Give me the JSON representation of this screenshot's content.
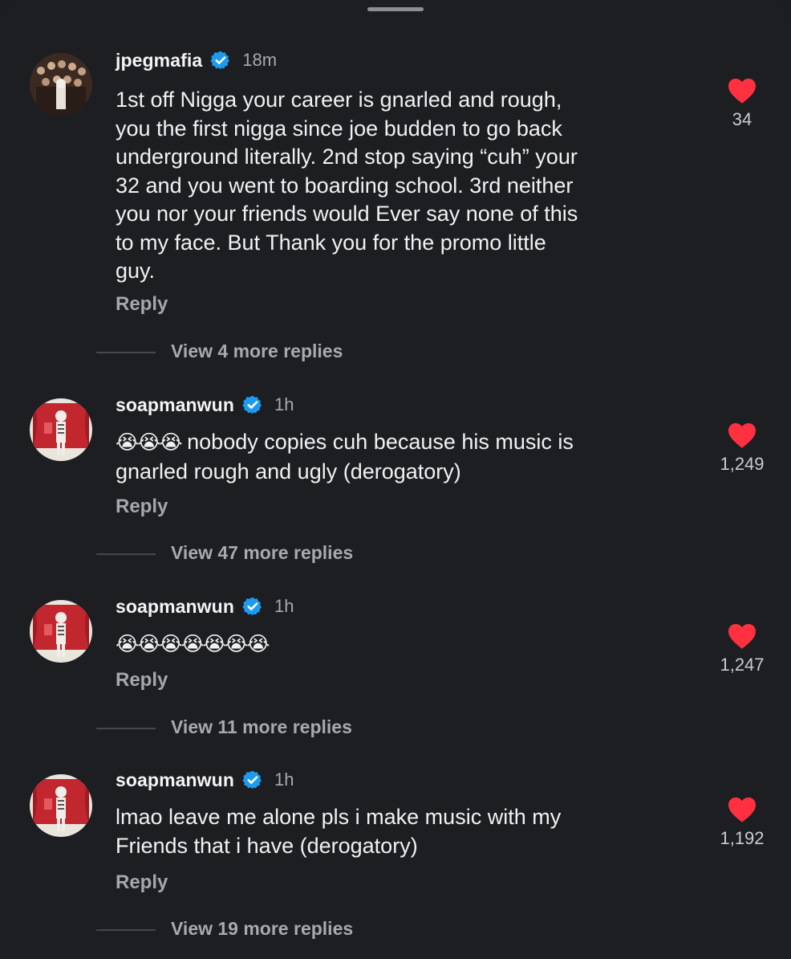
{
  "comments": [
    {
      "username": "jpegmafia",
      "verified": true,
      "time": "18m",
      "text": "1st off Nigga your career is gnarled and rough,\nyou the first nigga since joe budden to go back\nunderground literally. 2nd stop saying “cuh” your\n32 and you went to boarding school. 3rd neither\nyou nor your friends would Ever say none of this\nto my face. But Thank you for the promo little\nguy.",
      "emoji": "",
      "likes": "34",
      "reply_label": "Reply",
      "view_replies": "View 4 more replies"
    },
    {
      "username": "soapmanwun",
      "verified": true,
      "time": "1h",
      "emoji": "😭😭😭",
      "text": " nobody copies cuh because his music is\ngnarled rough and ugly (derogatory)",
      "likes": "1,249",
      "reply_label": "Reply",
      "view_replies": "View 47 more replies"
    },
    {
      "username": "soapmanwun",
      "verified": true,
      "time": "1h",
      "emoji": "😭😭😭😭😭😭😭",
      "text": "",
      "likes": "1,247",
      "reply_label": "Reply",
      "view_replies": "View 11 more replies"
    },
    {
      "username": "soapmanwun",
      "verified": true,
      "time": "1h",
      "emoji": "",
      "text": "lmao leave me alone pls i make music with my\nFriends that i have (derogatory)",
      "likes": "1,192",
      "reply_label": "Reply",
      "view_replies": "View 19 more replies"
    }
  ],
  "icons": {
    "like": "heart-icon",
    "verified": "verified-badge-icon",
    "handle": "drag-handle"
  },
  "colors": {
    "background": "#1c1e22",
    "heart": "#ff3040",
    "verified": "#1d9bf0",
    "muted_text": "#a7a9ad"
  }
}
